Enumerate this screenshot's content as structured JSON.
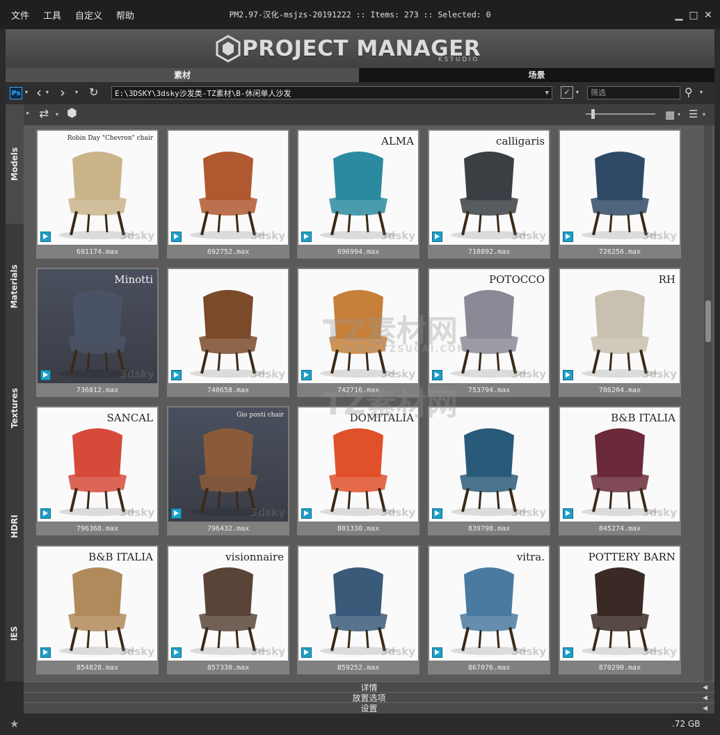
{
  "menu": [
    "文件",
    "工具",
    "自定义",
    "帮助"
  ],
  "window": {
    "title": "PM2.97-汉化-msjzs-20191222  :: Items: 273  :: Selected: 0",
    "minimize": "▁",
    "maximize": "□",
    "close": "✕"
  },
  "banner": {
    "logo": "PROJECT MANAGER",
    "sub": "KSTUDIO"
  },
  "tabs": {
    "materials": "素材",
    "scenes": "场景"
  },
  "toolbar": {
    "ps_label": "Ps",
    "path": "E:\\3DSKY\\3dsky沙发类-TZ素材\\B-休闲单人沙发",
    "filter_placeholder": "筛选"
  },
  "sidebar": [
    "Models",
    "Materials",
    "Textures",
    "HDRI",
    "IES"
  ],
  "items": [
    {
      "label": "691174.max",
      "color": "#c9b48a",
      "brand": "Robin Day \"Chevron\" chair"
    },
    {
      "label": "692752.max",
      "color": "#b0582f",
      "brand": ""
    },
    {
      "label": "696994.max",
      "color": "#2b8aa0",
      "brand": "ALMA"
    },
    {
      "label": "710892.max",
      "color": "#3a3f44",
      "brand": "calligaris"
    },
    {
      "label": "726256.max",
      "color": "#2f4a66",
      "brand": ""
    },
    {
      "label": "736812.max",
      "color": "#4a5266",
      "brand": "Minotti"
    },
    {
      "label": "740658.max",
      "color": "#7a4a2a",
      "brand": ""
    },
    {
      "label": "742716.max",
      "color": "#c6803a",
      "brand": ""
    },
    {
      "label": "753794.max",
      "color": "#8a8a96",
      "brand": "POTOCCO"
    },
    {
      "label": "786204.max",
      "color": "#c9c1b0",
      "brand": "RH"
    },
    {
      "label": "796368.max",
      "color": "#d64a3a",
      "brand": "SANCAL"
    },
    {
      "label": "796432.max",
      "color": "#8a5a3a",
      "brand": "Gio ponti chair"
    },
    {
      "label": "801330.max",
      "color": "#e0502a",
      "brand": "DOMITALIA"
    },
    {
      "label": "839798.max",
      "color": "#2a5a7a",
      "brand": ""
    },
    {
      "label": "845274.max",
      "color": "#6a2a3a",
      "brand": "B&B ITALIA"
    },
    {
      "label": "854828.max",
      "color": "#b08a5a",
      "brand": "B&B ITALIA"
    },
    {
      "label": "857330.max",
      "color": "#5a4438",
      "brand": "visionnaire"
    },
    {
      "label": "859252.max",
      "color": "#3a5a7a",
      "brand": ""
    },
    {
      "label": "867076.max",
      "color": "#4a7aa0",
      "brand": "vitra."
    },
    {
      "label": "870290.max",
      "color": "#3a2a26",
      "brand": "POTTERY BARN"
    }
  ],
  "panels": [
    "详情",
    "放置选项",
    "设置"
  ],
  "status": {
    "disk": ".72 GB"
  },
  "watermark": {
    "text": "TZ素材网",
    "url": "WWW.TZSUCAI.COM",
    "wm2": "3dsky"
  }
}
